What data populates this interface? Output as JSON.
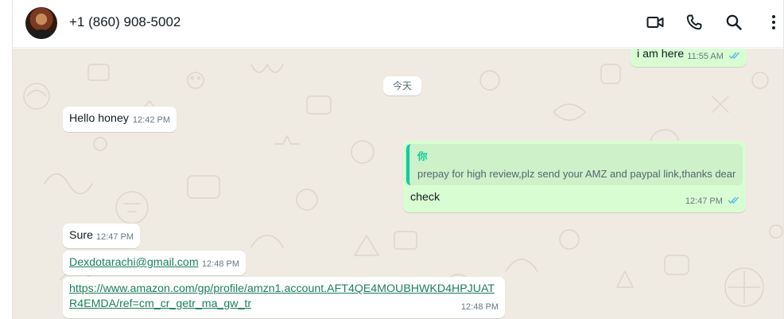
{
  "header": {
    "contact_name": "+1 (860) 908-5002",
    "icons": [
      "avatar",
      "video-call-icon",
      "voice-call-icon",
      "search-icon",
      "more-options-icon"
    ]
  },
  "date_separator": "今天",
  "messages": [
    {
      "direction": "out",
      "text": "i am here",
      "time": "11:55 AM",
      "status": "read"
    },
    {
      "direction": "in",
      "text": "Hello honey",
      "time": "12:42 PM"
    },
    {
      "direction": "out",
      "quote_author": "你",
      "quote_text": "prepay for high review,plz send your AMZ and paypal link,thanks dear",
      "text": "check",
      "time": "12:47 PM",
      "status": "read"
    },
    {
      "direction": "in",
      "text": "Sure",
      "time": "12:47 PM"
    },
    {
      "direction": "in",
      "text": "Dexdotarachi@gmail.com",
      "time": "12:48 PM",
      "is_link": true
    },
    {
      "direction": "in",
      "text_line1": "https://www.amazon.com/gp/profile/amzn1.account.AFT4QE4MOUBHWKD4HPJUAT",
      "text_line2": "R4EMDA/ref=cm_cr_getr_ma_gw_tr",
      "time": "12:48 PM",
      "is_link": true
    }
  ],
  "colors": {
    "outgoing_bubble": "#d9fdd3",
    "incoming_bubble": "#ffffff",
    "chat_bg": "#efeae2",
    "read_ticks": "#53bdeb"
  }
}
